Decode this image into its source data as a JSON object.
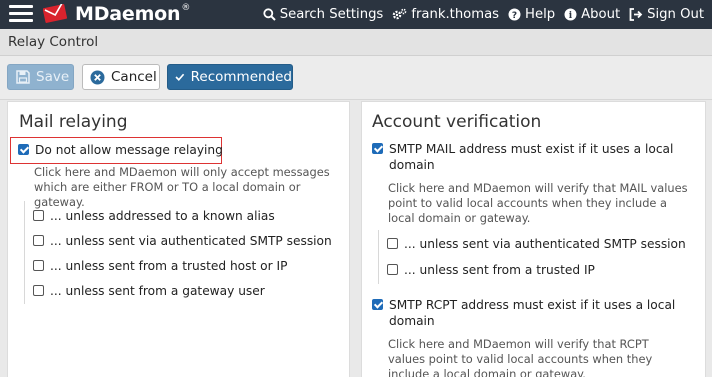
{
  "header": {
    "brand": "MDaemon",
    "brand_reg": "®",
    "nav": [
      {
        "icon": "search-icon",
        "label": "Search Settings"
      },
      {
        "icon": "cogs-icon",
        "label": "frank.thomas"
      },
      {
        "icon": "help-icon",
        "label": "Help"
      },
      {
        "icon": "info-icon",
        "label": "About"
      },
      {
        "icon": "sign-out-icon",
        "label": "Sign Out"
      }
    ]
  },
  "page": {
    "title": "Relay Control"
  },
  "toolbar": {
    "save_label": "Save",
    "cancel_label": "Cancel",
    "recommended_label": "Recommended"
  },
  "mail_relaying": {
    "title": "Mail relaying",
    "main_option": {
      "label": "Do not allow message relaying",
      "checked": true
    },
    "description": "Click here and MDaemon will only accept messages which are either FROM or TO a local domain or gateway.",
    "sub_options": [
      {
        "label": "... unless addressed to a known alias",
        "checked": false
      },
      {
        "label": "... unless sent via authenticated SMTP session",
        "checked": false
      },
      {
        "label": "... unless sent from a trusted host or IP",
        "checked": false
      },
      {
        "label": "... unless sent from a gateway user",
        "checked": false
      }
    ]
  },
  "account_verification": {
    "title": "Account verification",
    "mail_option": {
      "label": "SMTP MAIL address must exist if it uses a local domain",
      "checked": true
    },
    "mail_description": "Click here and MDaemon will verify that MAIL values point to valid local accounts when they include a local domain or gateway.",
    "mail_sub_options": [
      {
        "label": "... unless sent via authenticated SMTP session",
        "checked": false
      },
      {
        "label": "... unless sent from a trusted IP",
        "checked": false
      }
    ],
    "rcpt_option": {
      "label": "SMTP RCPT address must exist if it uses a local domain",
      "checked": true
    },
    "rcpt_description": "Click here and MDaemon will verify that RCPT values point to valid local accounts when they include a local domain or gateway."
  },
  "colors": {
    "topbar": "#2b3440",
    "recommended": "#2b6a9c",
    "checkbox": "#1e6bb8",
    "highlight": "#dd3333"
  }
}
